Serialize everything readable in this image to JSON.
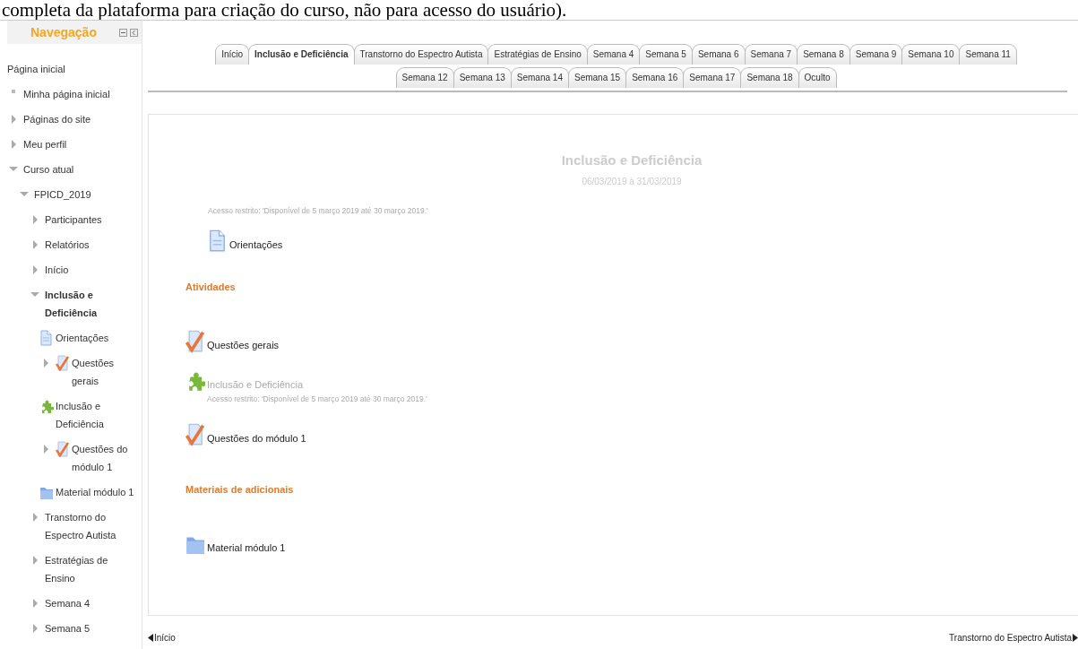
{
  "document_caption": "completa da plataforma para criação do curso, não para acesso do usuário).",
  "navigation": {
    "title": "Navegação",
    "items": [
      {
        "label": "Página inicial",
        "kind": "root",
        "selected": false
      },
      {
        "label": "Minha página inicial",
        "kind": "leaf",
        "selected": false
      },
      {
        "label": "Páginas do site",
        "kind": "branch",
        "expanded": false,
        "selected": false
      },
      {
        "label": "Meu perfil",
        "kind": "branch",
        "expanded": false,
        "selected": false
      },
      {
        "label": "Curso atual",
        "kind": "branch",
        "expanded": true,
        "selected": false,
        "children": [
          {
            "label": "FPICD_2019",
            "kind": "branch",
            "expanded": true,
            "selected": false,
            "children": [
              {
                "label": "Participantes",
                "kind": "branch",
                "expanded": false,
                "selected": false
              },
              {
                "label": "Relatórios",
                "kind": "branch",
                "expanded": false,
                "selected": false
              },
              {
                "label": "Início",
                "kind": "branch",
                "expanded": false,
                "selected": false
              },
              {
                "label": "Inclusão e Deficiência",
                "kind": "branch",
                "expanded": true,
                "selected": true,
                "children": [
                  {
                    "label": "Orientações",
                    "kind": "page",
                    "selected": false
                  },
                  {
                    "label": "Questões gerais",
                    "kind": "quiz",
                    "expanded": false,
                    "selected": false
                  },
                  {
                    "label": "Inclusão e Deficiência",
                    "kind": "puzzle",
                    "selected": false
                  },
                  {
                    "label": "Questões do módulo 1",
                    "kind": "quiz",
                    "expanded": false,
                    "selected": false
                  },
                  {
                    "label": "Material módulo 1",
                    "kind": "folder",
                    "selected": false
                  }
                ]
              },
              {
                "label": "Transtorno do Espectro Autista",
                "kind": "branch",
                "expanded": false,
                "selected": false
              },
              {
                "label": "Estratégias de Ensino",
                "kind": "branch",
                "expanded": false,
                "selected": false
              },
              {
                "label": "Semana 4",
                "kind": "branch",
                "expanded": false,
                "selected": false
              },
              {
                "label": "Semana 5",
                "kind": "branch",
                "expanded": false,
                "selected": false
              }
            ]
          }
        ]
      }
    ]
  },
  "tab_rows": [
    [
      {
        "label": "Início",
        "selected": false
      },
      {
        "label": "Inclusão e Deficiência",
        "selected": true
      },
      {
        "label": "Transtorno do Espectro Autista",
        "selected": false
      },
      {
        "label": "Estratégias de Ensino",
        "selected": false
      },
      {
        "label": "Semana 4",
        "selected": false
      },
      {
        "label": "Semana 5",
        "selected": false
      },
      {
        "label": "Semana 6",
        "selected": false
      },
      {
        "label": "Semana 7",
        "selected": false
      },
      {
        "label": "Semana 8",
        "selected": false
      },
      {
        "label": "Semana 9",
        "selected": false
      },
      {
        "label": "Semana 10",
        "selected": false
      },
      {
        "label": "Semana 11",
        "selected": false
      }
    ],
    [
      {
        "label": "Semana 12",
        "selected": false
      },
      {
        "label": "Semana 13",
        "selected": false
      },
      {
        "label": "Semana 14",
        "selected": false
      },
      {
        "label": "Semana 15",
        "selected": false
      },
      {
        "label": "Semana 16",
        "selected": false
      },
      {
        "label": "Semana 17",
        "selected": false
      },
      {
        "label": "Semana 18",
        "selected": false
      },
      {
        "label": "Oculto",
        "selected": false
      }
    ]
  ],
  "section": {
    "title": "Inclusão e Deficiência",
    "dates": "06/03/2019 à 31/03/2019",
    "restriction": "Acesso restrito: 'Disponível de 5 março 2019 até 30 março 2019.'",
    "summary_items": [
      {
        "kind": "page",
        "label": "Orientações",
        "dimmed": false
      }
    ],
    "blocks": [
      {
        "kind": "heading",
        "label": "Atividades"
      },
      {
        "kind": "quiz",
        "label": "Questões gerais",
        "dimmed": false
      },
      {
        "kind": "puzzle",
        "label": "Inclusão e Deficiência",
        "dimmed": true,
        "restriction": "Acesso restrito: 'Disponível de 5 março 2019 até 30 março 2019.'"
      },
      {
        "kind": "quiz",
        "label": "Questões do módulo 1",
        "dimmed": false
      },
      {
        "kind": "heading",
        "label": "Materiais de adicionais"
      },
      {
        "kind": "folder",
        "label": "Material módulo 1",
        "dimmed": false
      }
    ]
  },
  "section_nav": {
    "previous": "Início",
    "next": "Transtorno do Espectro Autista"
  }
}
